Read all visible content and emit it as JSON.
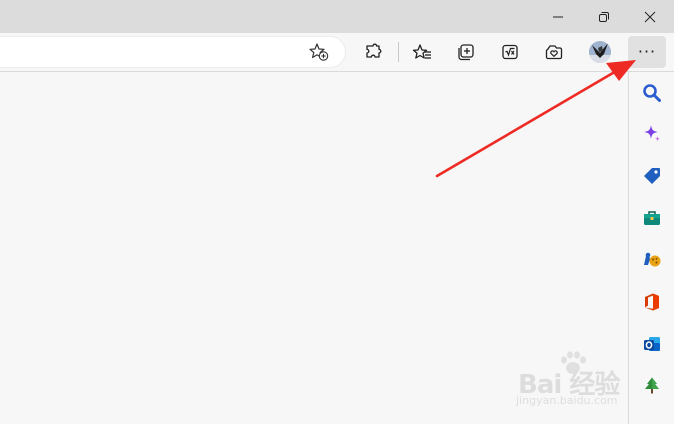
{
  "window": {
    "controls": [
      {
        "name": "minimize",
        "icon": "minimize-icon"
      },
      {
        "name": "restore",
        "icon": "restore-icon"
      },
      {
        "name": "close",
        "icon": "close-icon"
      }
    ]
  },
  "toolbar": {
    "address_value": "",
    "favorite_icon": "star-plus-icon",
    "buttons": [
      {
        "name": "extensions",
        "icon": "puzzle-icon"
      },
      {
        "name": "favorites",
        "icon": "favorites-icon"
      },
      {
        "name": "collections",
        "icon": "collections-icon"
      },
      {
        "name": "math-solver",
        "icon": "math-solver-icon"
      },
      {
        "name": "browser-essentials",
        "icon": "heart-shield-icon"
      },
      {
        "name": "profile",
        "icon": "avatar-icon"
      }
    ],
    "more_label": "···"
  },
  "sidebar": {
    "items": [
      {
        "name": "search",
        "icon": "search-icon",
        "color": "#2b5ccf"
      },
      {
        "name": "copilot",
        "icon": "sparkle-icon",
        "color": "#7b3fe4"
      },
      {
        "name": "shopping",
        "icon": "tag-icon",
        "color": "#1f5fbf"
      },
      {
        "name": "tools",
        "icon": "toolbox-icon",
        "color": "#0f8a7a"
      },
      {
        "name": "games",
        "icon": "games-icon",
        "color": "#e8a317"
      },
      {
        "name": "office",
        "icon": "office-icon",
        "color": "#d83b01"
      },
      {
        "name": "outlook",
        "icon": "outlook-icon",
        "color": "#0a64c8"
      },
      {
        "name": "drop",
        "icon": "tree-icon",
        "color": "#2e8b3a"
      }
    ]
  },
  "watermark": {
    "text": "Bai 经验",
    "sub": "jingyan.baidu.com"
  },
  "accent": {
    "arrow_color": "#ee2a24"
  }
}
